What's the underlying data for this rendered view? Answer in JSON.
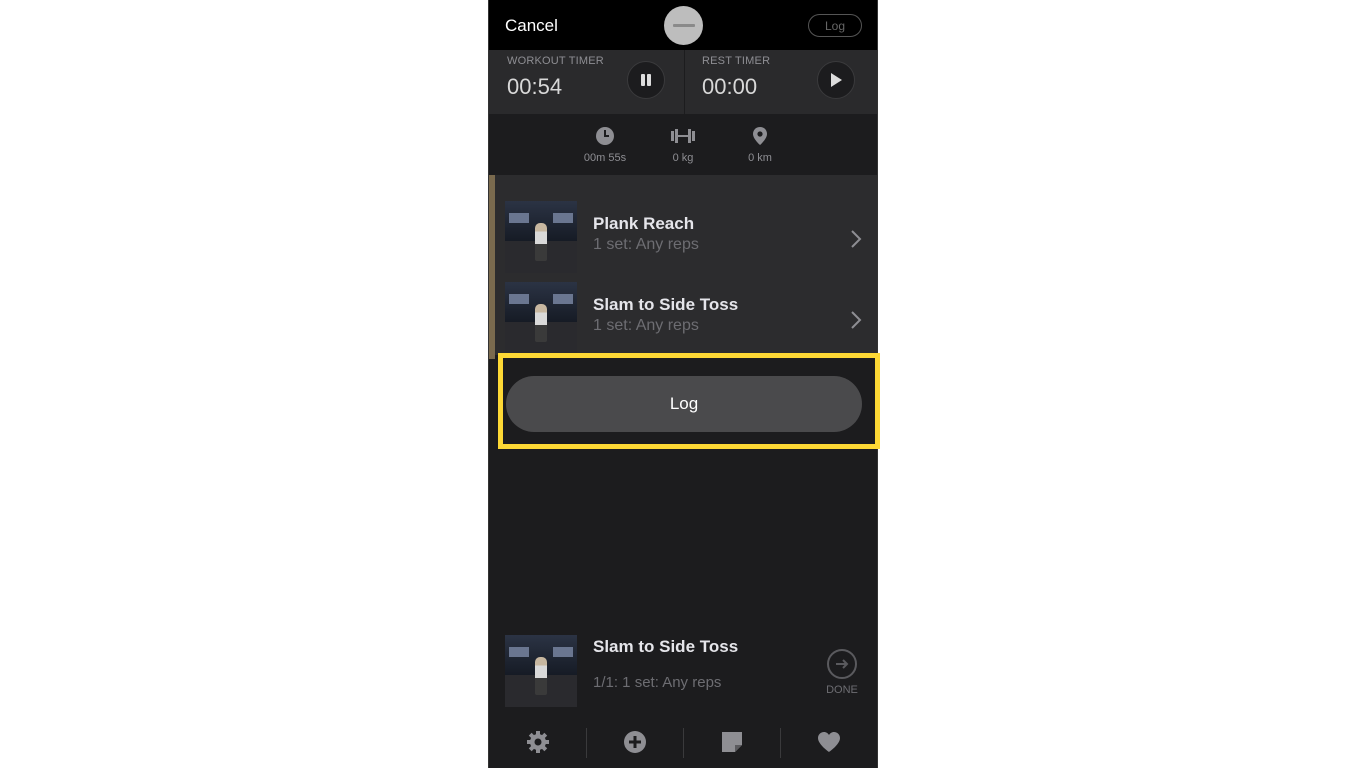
{
  "header": {
    "cancel_label": "Cancel",
    "log_label": "Log"
  },
  "timers": {
    "workout_label": "WORKOUT TIMER",
    "workout_value": "00:54",
    "rest_label": "REST TIMER",
    "rest_value": "00:00"
  },
  "stats": [
    {
      "icon": "clock-icon",
      "value": "00m 55s"
    },
    {
      "icon": "dumbbell-icon",
      "value": "0 kg"
    },
    {
      "icon": "location-pin-icon",
      "value": "0 km"
    }
  ],
  "exercises": [
    {
      "title": "Plank Reach",
      "subtitle": "1 set: Any reps"
    },
    {
      "title": "Slam to Side Toss",
      "subtitle": "1 set: Any reps"
    }
  ],
  "log_button_label": "Log",
  "now_playing": {
    "title": "Slam to Side Toss",
    "subtitle": "1/1:  1 set: Any reps",
    "done_label": "DONE"
  },
  "tabbar": [
    "gear-icon",
    "add-circle-icon",
    "note-icon",
    "heart-icon"
  ],
  "colors": {
    "highlight": "#fdd835",
    "background": "#1c1c1e",
    "accent_bar": "#7a6a4e"
  }
}
